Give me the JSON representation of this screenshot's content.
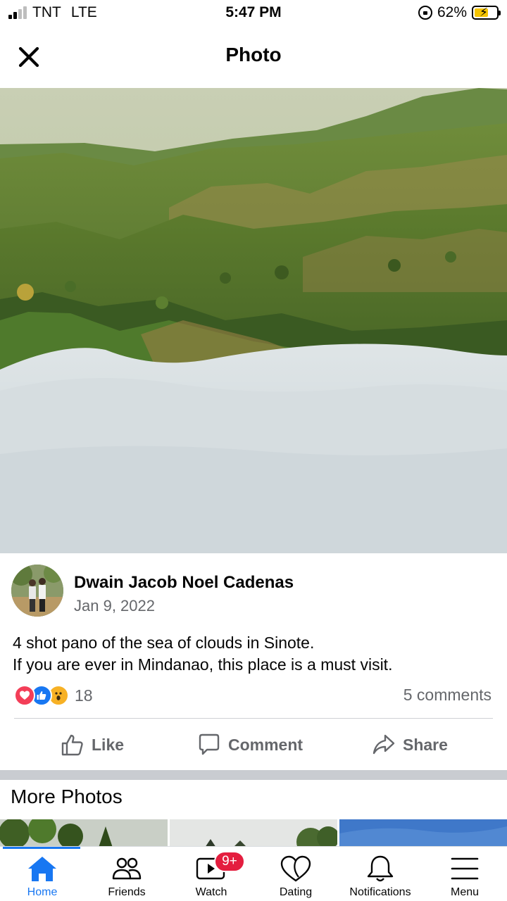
{
  "status_bar": {
    "carrier": "TNT",
    "network": "LTE",
    "time": "5:47 PM",
    "battery_percent": "62%",
    "battery_level": 0.62,
    "signal_bars_on": 2,
    "signal_bars_total": 4
  },
  "header": {
    "title": "Photo",
    "close_icon": "close-icon"
  },
  "photo": {
    "subject": "sea of clouds over green hills"
  },
  "post": {
    "author": "Dwain Jacob Noel Cadenas",
    "date": "Jan 9, 2022",
    "caption_line1": "4 shot pano of the sea of clouds in Sinote.",
    "caption_line2": "If you are ever in Mindanao, this place is a must visit.",
    "reactions": [
      "love",
      "like",
      "wow"
    ],
    "reaction_count": "18",
    "comments_count": "5 comments",
    "actions": {
      "like": "Like",
      "comment": "Comment",
      "share": "Share"
    }
  },
  "more_photos": {
    "title": "More Photos"
  },
  "tabbar": {
    "active": "home",
    "accent_color": "#1877f2",
    "tabs": [
      {
        "id": "home",
        "label": "Home",
        "icon": "home-icon"
      },
      {
        "id": "friends",
        "label": "Friends",
        "icon": "friends-icon"
      },
      {
        "id": "watch",
        "label": "Watch",
        "icon": "watch-icon",
        "badge": "9+"
      },
      {
        "id": "dating",
        "label": "Dating",
        "icon": "dating-icon"
      },
      {
        "id": "notifications",
        "label": "Notifications",
        "icon": "bell-icon"
      },
      {
        "id": "menu",
        "label": "Menu",
        "icon": "menu-icon"
      }
    ]
  }
}
